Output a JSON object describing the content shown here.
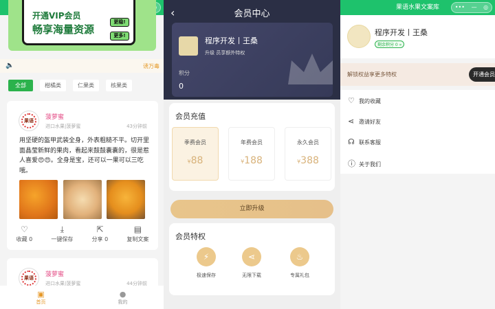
{
  "app_title": "果语水果文案库",
  "capsule": {
    "more": "•••",
    "min": "—"
  },
  "feed": {
    "banner": {
      "line1": "开通VIP会员",
      "line2": "畅享海量资源",
      "btn1": "更稳!",
      "btn2": "更多!"
    },
    "notice": "诱万毒",
    "tabs": [
      "全部",
      "柑橘类",
      "仁果类",
      "核果类"
    ],
    "posts": [
      {
        "logo": "果语",
        "name": "菠萝蜜",
        "sub": "进口水果|菠萝蜜",
        "time": "43分钟前",
        "text": "用坚硬的盔甲武装全身，外表粗糙不平。切开里面晶莹新鲜的果肉，看起来鼓鼓囊囊的，很是惹人喜爱😍😍。全身是宝，还可以一果可以三吃哦。",
        "actions": [
          "收藏 0",
          "一键保存",
          "分享 0",
          "复制文案"
        ]
      },
      {
        "logo": "果语",
        "name": "菠萝蜜",
        "sub": "进口水果|菠萝蜜",
        "time": "44分钟前"
      }
    ],
    "nav": [
      "首页",
      "我的"
    ]
  },
  "member": {
    "title": "会员中心",
    "user": {
      "name": "程序开发丨王桑",
      "hint": "升级        员享额外特权",
      "points_label": "积分",
      "points": "0"
    },
    "recharge": {
      "title": "会员充值",
      "currency": "¥",
      "plans": [
        {
          "name": "季费会员",
          "price": "88"
        },
        {
          "name": "年费会员",
          "price": "188"
        },
        {
          "name": "永久会员",
          "price": "388"
        }
      ]
    },
    "upgrade": "立即升级",
    "privileges": {
      "title": "会员特权",
      "items": [
        "极速保存",
        "无限下载",
        "专属礼包"
      ]
    }
  },
  "profile": {
    "name": "程序开发丨王桑",
    "tag": "剩余积分 0 »",
    "unlock": {
      "text": "解锁权益享更多特权",
      "btn": "开通会员"
    },
    "menu": [
      "我的收藏",
      "邀请好友",
      "联系客服",
      "关于我们"
    ]
  },
  "colors": {
    "green": "#2bb24c",
    "header": "#1ec26c",
    "dark": "#2b2f45",
    "gold": "#e6c08a"
  }
}
